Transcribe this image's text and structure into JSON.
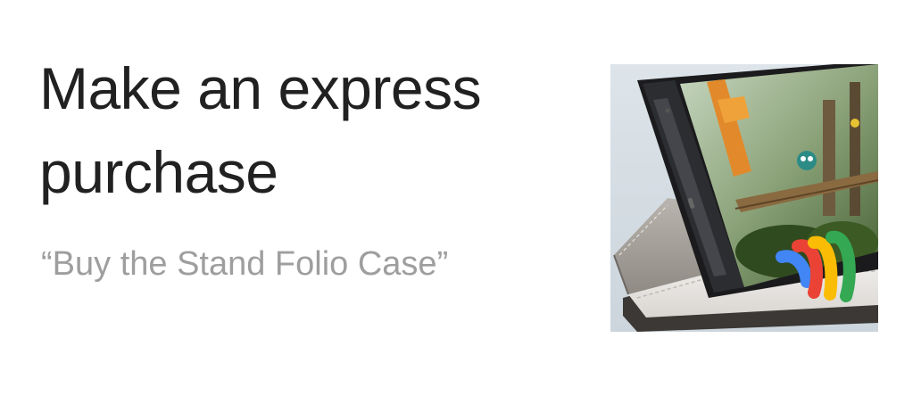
{
  "headline": {
    "line1": "Make an express",
    "line2": "purchase"
  },
  "example_query": "“Buy the Stand Folio Case”",
  "image": {
    "subject": "phone-in-stand-folio-case",
    "logo": "google-wallet-logo",
    "colors": {
      "background": "#d5dde3",
      "wallet_blue": "#4285f4",
      "wallet_red": "#ea4335",
      "wallet_yellow": "#fbbc05",
      "wallet_green": "#34a853"
    }
  }
}
